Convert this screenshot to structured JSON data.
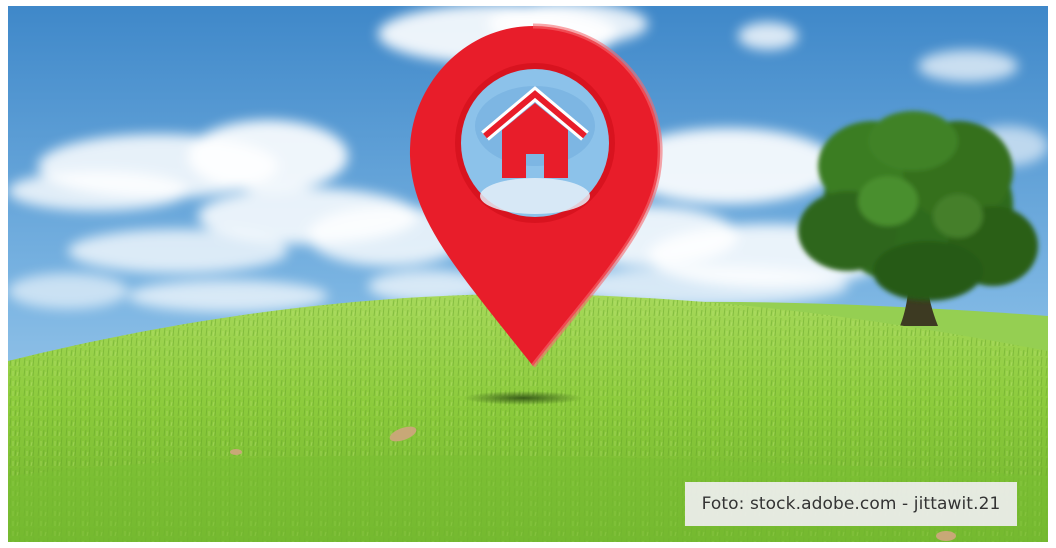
{
  "photo": {
    "subject": "location-pin-icon",
    "pin_icon": "house-icon",
    "colors": {
      "pin": "#e81d2a",
      "sky_top": "#3f88c9",
      "sky_bottom": "#a9cdea",
      "grass": "#8ccb3c",
      "tree": "#2f6a1c"
    }
  },
  "credit": {
    "text": "Foto: stock.adobe.com - jittawit.21"
  }
}
